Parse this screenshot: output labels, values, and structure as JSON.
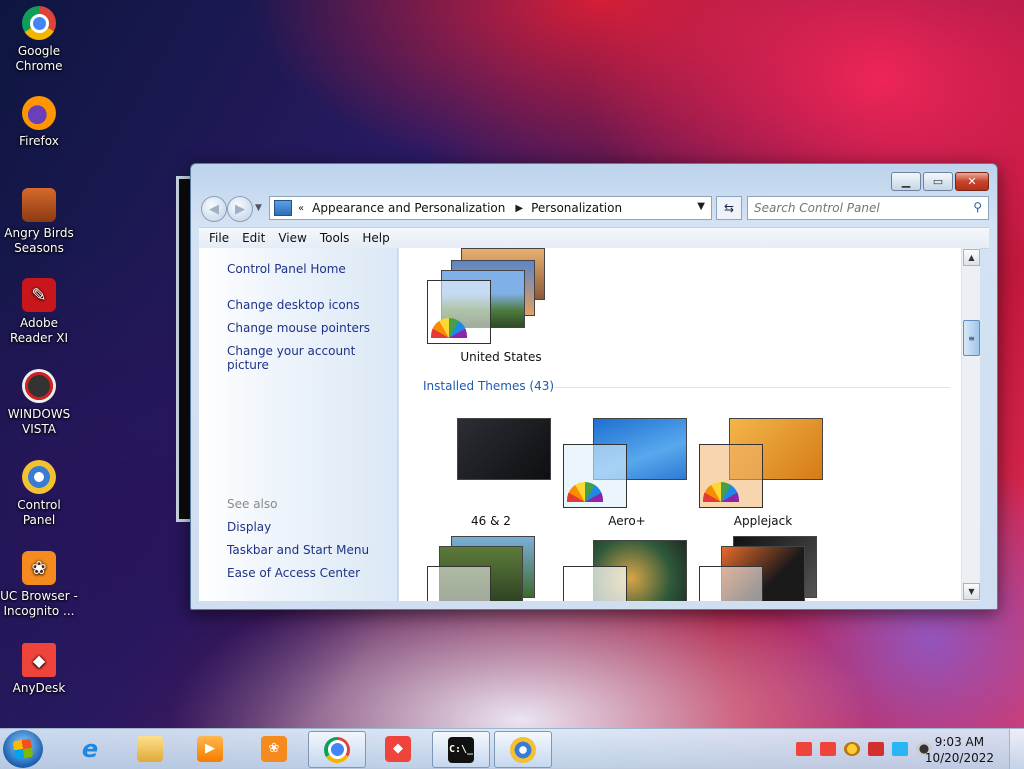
{
  "desktop": {
    "icons": [
      {
        "label": "Google Chrome"
      },
      {
        "label": "Firefox"
      },
      {
        "label": "Angry Birds Seasons"
      },
      {
        "label": "Adobe Reader XI"
      },
      {
        "label": "WINDOWS VISTA"
      },
      {
        "label": "Control Panel"
      },
      {
        "label": "UC Browser - Incognito ..."
      },
      {
        "label": "AnyDesk"
      }
    ]
  },
  "window": {
    "address": {
      "chevrons": "«",
      "crumbs": [
        "Appearance and Personalization",
        "Personalization"
      ]
    },
    "search": {
      "placeholder": "Search Control Panel"
    },
    "menu": [
      "File",
      "Edit",
      "View",
      "Tools",
      "Help"
    ],
    "left_pane": {
      "home": "Control Panel Home",
      "links": [
        "Change desktop icons",
        "Change mouse pointers",
        "Change your account picture"
      ],
      "see_also_title": "See also",
      "see_also": [
        "Display",
        "Taskbar and Start Menu",
        "Ease of Access Center"
      ]
    },
    "content": {
      "top_theme": "United States",
      "installed_header": "Installed Themes (43)",
      "themes": [
        "46 & 2",
        "Aero+",
        "Applejack"
      ]
    }
  },
  "taskbar": {
    "clock_time": "9:03 AM",
    "clock_date": "10/20/2022"
  },
  "colors": {
    "link": "#1e3287",
    "group_header": "#1e5aa8",
    "close_button": "#c7432a"
  }
}
